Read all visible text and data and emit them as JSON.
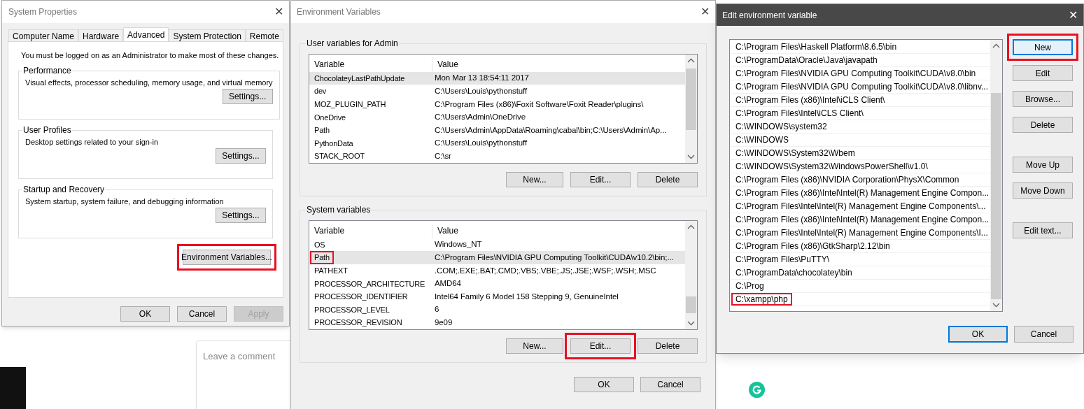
{
  "background": {
    "comment_placeholder": "Leave a comment"
  },
  "system_properties": {
    "title": "System Properties",
    "close": "✕",
    "tabs": [
      {
        "label": "Computer Name",
        "selected": false
      },
      {
        "label": "Hardware",
        "selected": false
      },
      {
        "label": "Advanced",
        "selected": true
      },
      {
        "label": "System Protection",
        "selected": false
      },
      {
        "label": "Remote",
        "selected": false
      }
    ],
    "notice": "You must be logged on as an Administrator to make most of these changes.",
    "groups": [
      {
        "title": "Performance",
        "description": "Visual effects, processor scheduling, memory usage, and virtual memory",
        "button": "Settings..."
      },
      {
        "title": "User Profiles",
        "description": "Desktop settings related to your sign-in",
        "button": "Settings..."
      },
      {
        "title": "Startup and Recovery",
        "description": "System startup, system failure, and debugging information",
        "button": "Settings..."
      }
    ],
    "env_button": {
      "label": "Environment Variables...",
      "highlighted": true
    },
    "footer_buttons": [
      {
        "label": "OK",
        "disabled": false
      },
      {
        "label": "Cancel",
        "disabled": false
      },
      {
        "label": "Apply",
        "disabled": true
      }
    ]
  },
  "environment_variables": {
    "title": "Environment Variables",
    "close": "✕",
    "user_variables": {
      "title": "User variables for Admin",
      "columns": [
        "Variable",
        "Value"
      ],
      "rows": [
        {
          "variable": "ChocolateyLastPathUpdate",
          "value": "Mon Mar 13 18:54:11 2017",
          "selected": true,
          "highlighted": false
        },
        {
          "variable": "dev",
          "value": "C:\\Users\\Louis\\pythonstuff",
          "selected": false,
          "highlighted": false
        },
        {
          "variable": "MOZ_PLUGIN_PATH",
          "value": "C:\\Program Files (x86)\\Foxit Software\\Foxit Reader\\plugins\\",
          "selected": false,
          "highlighted": false
        },
        {
          "variable": "OneDrive",
          "value": "C:\\Users\\Admin\\OneDrive",
          "selected": false,
          "highlighted": false
        },
        {
          "variable": "Path",
          "value": "C:\\Users\\Admin\\AppData\\Roaming\\cabal\\bin;C:\\Users\\Admin\\Ap...",
          "selected": false,
          "highlighted": false
        },
        {
          "variable": "PythonData",
          "value": "C:\\Users\\Louis\\pythonstuff",
          "selected": false,
          "highlighted": false
        },
        {
          "variable": "STACK_ROOT",
          "value": "C:\\sr",
          "selected": false,
          "highlighted": false
        }
      ],
      "buttons": [
        {
          "label": "New...",
          "highlighted": false
        },
        {
          "label": "Edit...",
          "highlighted": false
        },
        {
          "label": "Delete",
          "highlighted": false
        }
      ]
    },
    "system_variables": {
      "title": "System variables",
      "columns": [
        "Variable",
        "Value"
      ],
      "rows": [
        {
          "variable": "OS",
          "value": "Windows_NT",
          "selected": false,
          "highlighted": false
        },
        {
          "variable": "Path",
          "value": "C:\\Program Files\\NVIDIA GPU Computing Toolkit\\CUDA\\v10.2\\bin;...",
          "selected": true,
          "highlighted": true
        },
        {
          "variable": "PATHEXT",
          "value": ".COM;.EXE;.BAT;.CMD;.VBS;.VBE;.JS;.JSE;.WSF;.WSH;.MSC",
          "selected": false,
          "highlighted": false
        },
        {
          "variable": "PROCESSOR_ARCHITECTURE",
          "value": "AMD64",
          "selected": false,
          "highlighted": false
        },
        {
          "variable": "PROCESSOR_IDENTIFIER",
          "value": "Intel64 Family 6 Model 158 Stepping 9, GenuineIntel",
          "selected": false,
          "highlighted": false
        },
        {
          "variable": "PROCESSOR_LEVEL",
          "value": "6",
          "selected": false,
          "highlighted": false
        },
        {
          "variable": "PROCESSOR_REVISION",
          "value": "9e09",
          "selected": false,
          "highlighted": false
        }
      ],
      "buttons": [
        {
          "label": "New...",
          "highlighted": false
        },
        {
          "label": "Edit...",
          "highlighted": true
        },
        {
          "label": "Delete",
          "highlighted": false
        }
      ]
    },
    "footer_buttons": [
      {
        "label": "OK"
      },
      {
        "label": "Cancel"
      }
    ]
  },
  "edit_variable": {
    "title": "Edit environment variable",
    "close": "✕",
    "entries": [
      {
        "text": "C:\\Program Files\\Haskell Platform\\8.6.5\\bin",
        "highlighted": false
      },
      {
        "text": "C:\\ProgramData\\Oracle\\Java\\javapath",
        "highlighted": false
      },
      {
        "text": "C:\\Program Files\\NVIDIA GPU Computing Toolkit\\CUDA\\v8.0\\bin",
        "highlighted": false
      },
      {
        "text": "C:\\Program Files\\NVIDIA GPU Computing Toolkit\\CUDA\\v8.0\\libnv...",
        "highlighted": false
      },
      {
        "text": "C:\\Program Files (x86)\\Intel\\iCLS Client\\",
        "highlighted": false
      },
      {
        "text": "C:\\Program Files\\Intel\\iCLS Client\\",
        "highlighted": false
      },
      {
        "text": "C:\\WINDOWS\\system32",
        "highlighted": false
      },
      {
        "text": "C:\\WINDOWS",
        "highlighted": false
      },
      {
        "text": "C:\\WINDOWS\\System32\\Wbem",
        "highlighted": false
      },
      {
        "text": "C:\\WINDOWS\\System32\\WindowsPowerShell\\v1.0\\",
        "highlighted": false
      },
      {
        "text": "C:\\Program Files (x86)\\NVIDIA Corporation\\PhysX\\Common",
        "highlighted": false
      },
      {
        "text": "C:\\Program Files (x86)\\Intel\\Intel(R) Management Engine Compon...",
        "highlighted": false
      },
      {
        "text": "C:\\Program Files\\Intel\\Intel(R) Management Engine Components\\...",
        "highlighted": false
      },
      {
        "text": "C:\\Program Files (x86)\\Intel\\Intel(R) Management Engine Compon...",
        "highlighted": false
      },
      {
        "text": "C:\\Program Files\\Intel\\Intel(R) Management Engine Components\\I...",
        "highlighted": false
      },
      {
        "text": "C:\\Program Files (x86)\\GtkSharp\\2.12\\bin",
        "highlighted": false
      },
      {
        "text": "C:\\Program Files\\PuTTY\\",
        "highlighted": false
      },
      {
        "text": "C:\\ProgramData\\chocolatey\\bin",
        "highlighted": false
      },
      {
        "text": "C:\\Prog",
        "highlighted": false
      },
      {
        "text": "C:\\xampp\\php",
        "highlighted": true
      }
    ],
    "side_button_groups": [
      [
        {
          "label": "New",
          "focused": true,
          "highlighted": true
        },
        {
          "label": "Edit",
          "focused": false,
          "highlighted": false
        },
        {
          "label": "Browse...",
          "focused": false,
          "highlighted": false
        },
        {
          "label": "Delete",
          "focused": false,
          "highlighted": false
        }
      ],
      [
        {
          "label": "Move Up",
          "focused": false,
          "highlighted": false
        },
        {
          "label": "Move Down",
          "focused": false,
          "highlighted": false
        }
      ],
      [
        {
          "label": "Edit text...",
          "focused": false,
          "highlighted": false
        }
      ]
    ],
    "footer_buttons": [
      {
        "label": "OK",
        "default": true
      },
      {
        "label": "Cancel",
        "default": false
      }
    ]
  }
}
